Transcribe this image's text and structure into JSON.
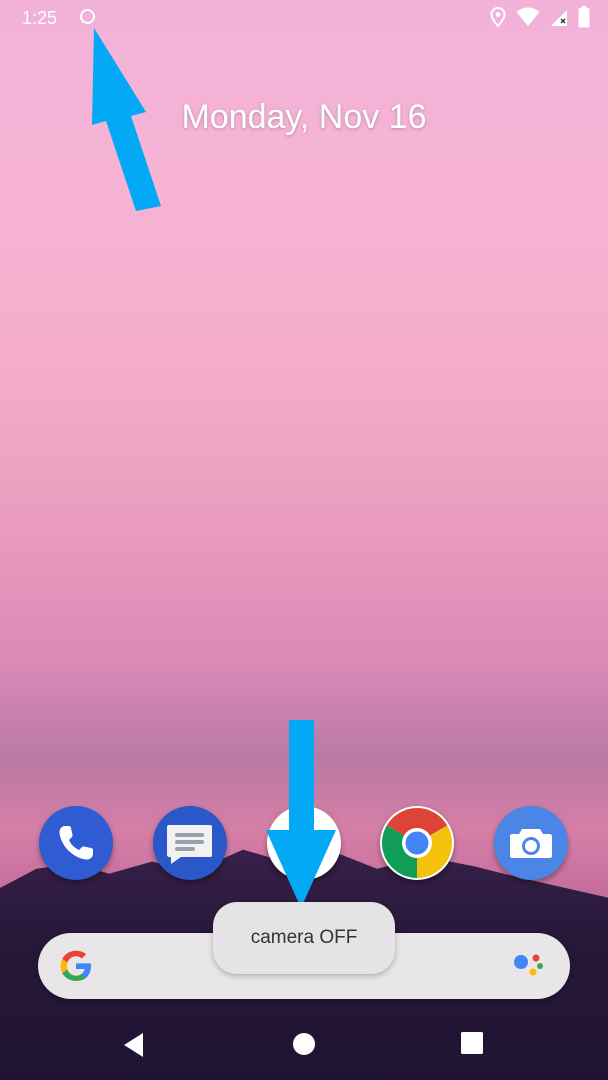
{
  "status_bar": {
    "time": "1:25",
    "icons": [
      "circle-icon",
      "location-icon",
      "wifi-icon",
      "signal-icon",
      "battery-icon"
    ]
  },
  "home": {
    "date": "Monday, Nov 16"
  },
  "dock": {
    "apps": [
      "phone-icon",
      "messages-icon",
      "play-store-icon",
      "chrome-icon",
      "camera-icon"
    ]
  },
  "toast": {
    "text": "camera OFF"
  },
  "search_bar": {
    "left_icon": "google-g-icon",
    "right_icon": "assistant-icon"
  },
  "nav": {
    "buttons": [
      "back-icon",
      "home-icon",
      "recents-icon"
    ]
  },
  "colors": {
    "arrow": "#03a9f4",
    "phone": "#2f5bd3",
    "chrome_red": "#db4437",
    "chrome_yellow": "#f4c20d",
    "chrome_green": "#0f9d58",
    "chrome_blue": "#4285f4"
  }
}
